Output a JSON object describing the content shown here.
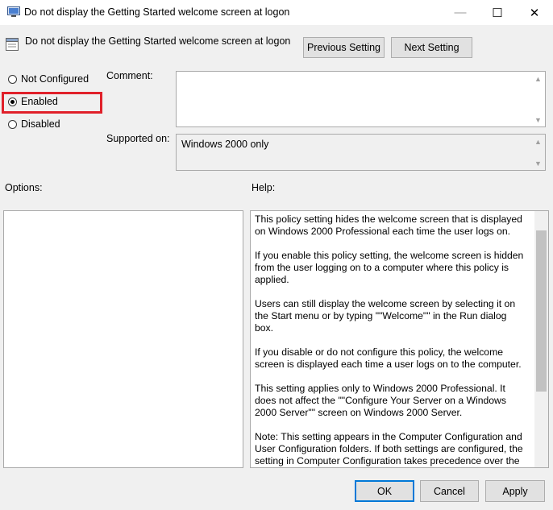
{
  "window": {
    "title": "Do not display the Getting Started welcome screen at logon",
    "controls": {
      "minimize": "—",
      "maximize": "☐",
      "close": "✕"
    }
  },
  "header": {
    "policy_name": "Do not display the Getting Started welcome screen at logon",
    "previous_label": "Previous Setting",
    "next_label": "Next Setting"
  },
  "state": {
    "options": [
      {
        "label": "Not Configured",
        "selected": false
      },
      {
        "label": "Enabled",
        "selected": true
      },
      {
        "label": "Disabled",
        "selected": false
      }
    ]
  },
  "comment": {
    "label": "Comment:",
    "value": ""
  },
  "supported": {
    "label": "Supported on:",
    "value": "Windows 2000 only"
  },
  "options_panel": {
    "label": "Options:"
  },
  "help": {
    "label": "Help:",
    "paragraphs": [
      "This policy setting hides the welcome screen that is displayed on Windows 2000 Professional each time the user logs on.",
      "If you enable this policy setting, the welcome screen is hidden from the user logging on to a computer where this policy is applied.",
      "Users can still display the welcome screen by selecting it on the Start menu or by typing \"\"Welcome\"\" in the Run dialog box.",
      "If you disable or do not configure this policy, the welcome screen is displayed each time a user logs on to the computer.",
      "This setting applies only to Windows 2000 Professional. It does not affect the \"\"Configure Your Server on a Windows 2000 Server\"\" screen on Windows 2000 Server.",
      "Note: This setting appears in the Computer Configuration and User Configuration folders. If both settings are configured, the setting in Computer Configuration takes precedence over the setting in User Configuration."
    ]
  },
  "footer": {
    "ok_label": "OK",
    "cancel_label": "Cancel",
    "apply_label": "Apply"
  },
  "colors": {
    "highlight": "#e0202a",
    "accent": "#0078d7"
  }
}
